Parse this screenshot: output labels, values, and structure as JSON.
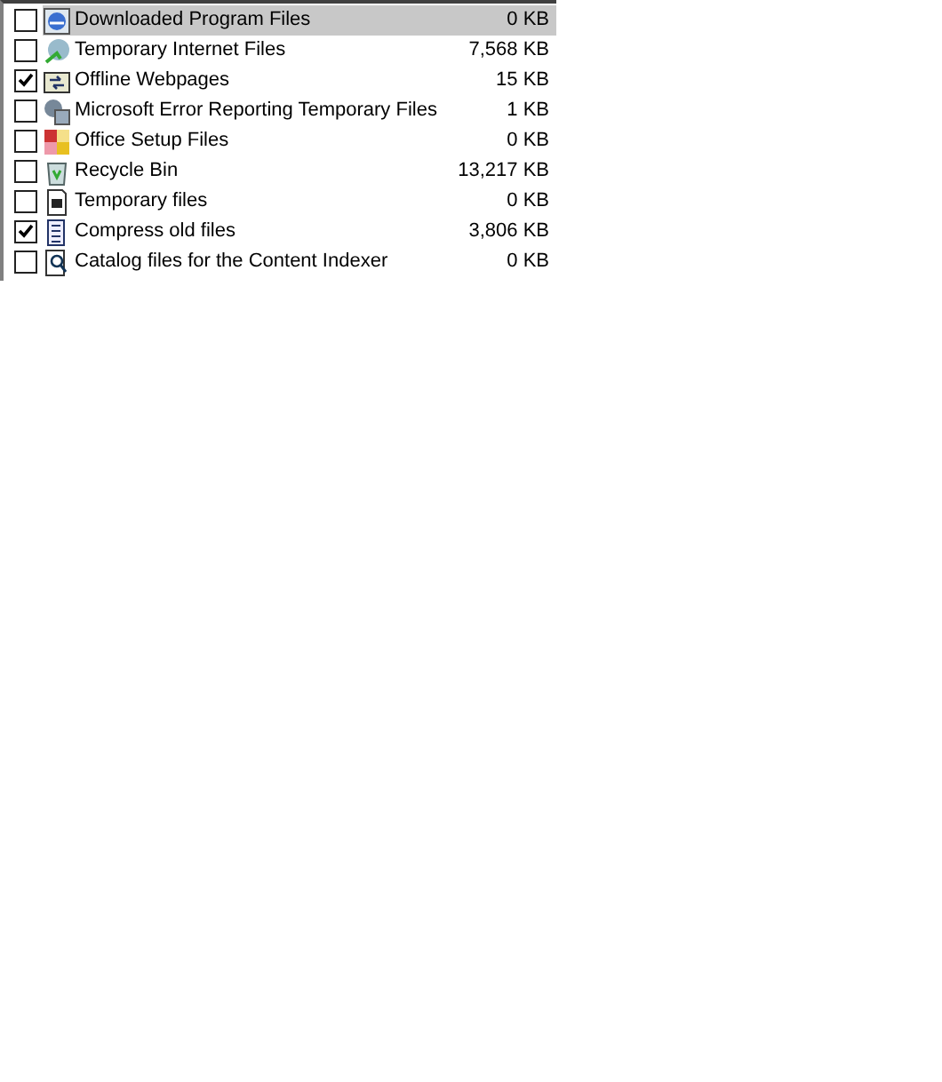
{
  "items": [
    {
      "label": "Downloaded Program Files",
      "size": "0 KB",
      "checked": false,
      "selected": true
    },
    {
      "label": "Temporary Internet Files",
      "size": "7,568 KB",
      "checked": false,
      "selected": false
    },
    {
      "label": "Offline Webpages",
      "size": "15 KB",
      "checked": true,
      "selected": false
    },
    {
      "label": "Microsoft Error Reporting Temporary Files",
      "size": "1 KB",
      "checked": false,
      "selected": false
    },
    {
      "label": "Office Setup Files",
      "size": "0 KB",
      "checked": false,
      "selected": false
    },
    {
      "label": "Recycle Bin",
      "size": "13,217 KB",
      "checked": false,
      "selected": false
    },
    {
      "label": "Temporary files",
      "size": "0 KB",
      "checked": false,
      "selected": false
    },
    {
      "label": "Compress old files",
      "size": "3,806 KB",
      "checked": true,
      "selected": false
    },
    {
      "label": "Catalog files for the Content Indexer",
      "size": "0 KB",
      "checked": false,
      "selected": false
    }
  ]
}
